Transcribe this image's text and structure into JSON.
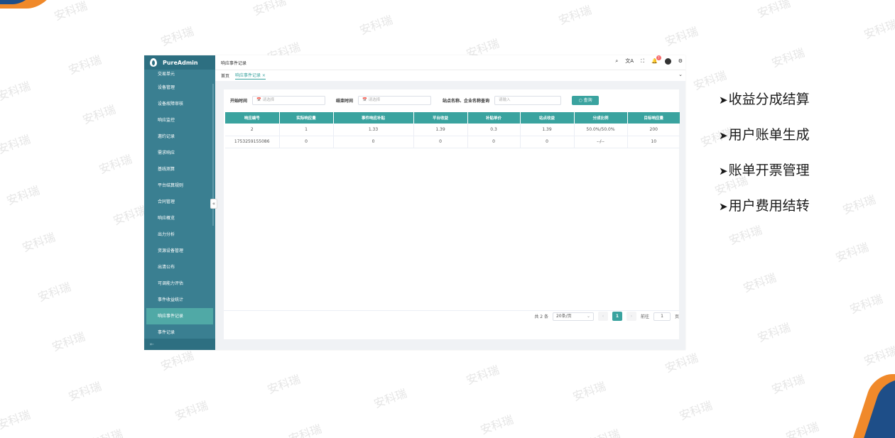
{
  "watermark": "安科瑞",
  "app": {
    "brand": "PureAdmin",
    "header_title": "响应事件记录",
    "notification_count": "7",
    "tabs": [
      {
        "label": "首页"
      },
      {
        "label": "响应事件记录 ×"
      }
    ],
    "menu": [
      "交易单元",
      "设备管理",
      "设备故障审核",
      "响应监控",
      "邀约记录",
      "需求响应",
      "基线测算",
      "平台结算规则",
      "合同管理",
      "响应概览",
      "出力分析",
      "资源设备管理",
      "出清公布",
      "可调能力评估",
      "事件收益统计",
      "响应事件记录",
      "事件记录"
    ],
    "active_menu": "响应事件记录",
    "filters": {
      "start_label": "开始时间",
      "start_placeholder": "请选择",
      "end_label": "结束时间",
      "end_placeholder": "请选择",
      "site_label": "站点名称、企业名称查询",
      "site_placeholder": "请输入",
      "query_button": "查询"
    },
    "table": {
      "headers": [
        "响应编号",
        "实际响应量",
        "事件响应补贴",
        "平台收益",
        "补贴单价",
        "站点收益",
        "分成比例",
        "目标响应量"
      ],
      "rows": [
        [
          "2",
          "1",
          "1.33",
          "1.39",
          "0.3",
          "1.39",
          "50.0%/50.0%",
          "200"
        ],
        [
          "1753259155086",
          "0",
          "0",
          "0",
          "0",
          "0",
          "--/--",
          "10"
        ]
      ]
    },
    "pager": {
      "total": "共 2 条",
      "page_size": "20条/页",
      "current_page": "1",
      "goto_label": "前往",
      "goto_value": "1",
      "page_suffix": "页"
    }
  },
  "bullets": [
    "收益分成结算",
    "用户账单生成",
    "账单开票管理",
    "用户费用结转"
  ],
  "colors": {
    "sidebar": "#3a7f91",
    "accent": "#3aa39f",
    "orange": "#f0892a",
    "navy": "#1e4e88"
  }
}
